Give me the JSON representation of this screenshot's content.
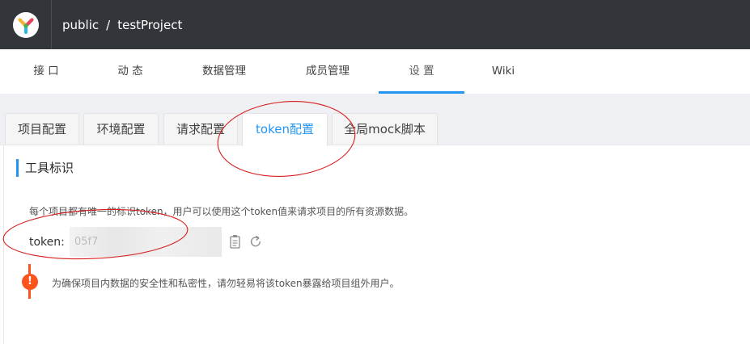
{
  "header": {
    "group": "public",
    "separator": "/",
    "project": "testProject",
    "logo_icon": "yapi-logo-icon"
  },
  "topnav": {
    "items": [
      {
        "label": "接 口"
      },
      {
        "label": "动 态"
      },
      {
        "label": "数据管理"
      },
      {
        "label": "成员管理"
      },
      {
        "label": "设 置"
      },
      {
        "label": "Wiki"
      }
    ],
    "active_index": 4,
    "accent_color": "#2395f1"
  },
  "tabs": {
    "items": [
      {
        "label": "项目配置"
      },
      {
        "label": "环境配置"
      },
      {
        "label": "请求配置"
      },
      {
        "label": "token配置"
      },
      {
        "label": "全局mock脚本"
      }
    ],
    "active_index": 3
  },
  "section": {
    "title": "工具标识",
    "description": "每个项目都有唯一的标识token，用户可以使用这个token值来请求项目的所有资源数据。",
    "token_label": "token:",
    "token_value": "05f7",
    "copy_icon": "copy-icon",
    "refresh_icon": "refresh-icon"
  },
  "warning": {
    "icon_text": "!",
    "text": "为确保项目内数据的安全性和私密性，请勿轻易将该token暴露给项目组外用户。",
    "color": "#fa541c"
  }
}
